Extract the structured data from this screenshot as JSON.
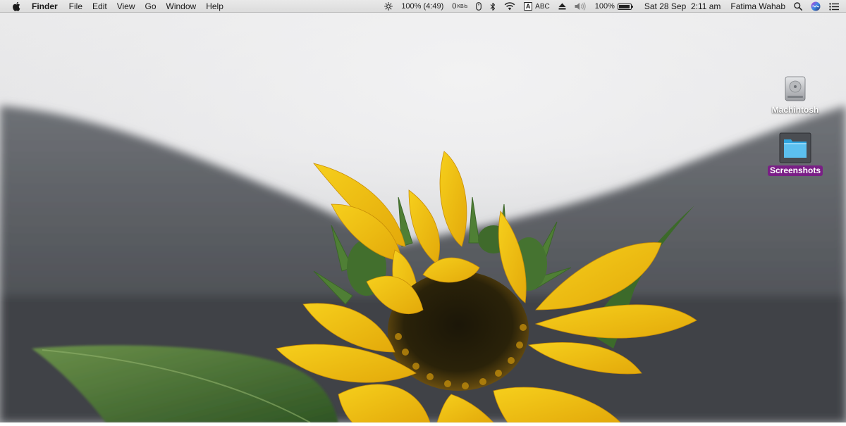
{
  "menubar": {
    "apple_icon": "apple-logo",
    "app_name": "Finder",
    "menus": [
      "File",
      "Edit",
      "View",
      "Go",
      "Window",
      "Help"
    ],
    "status": {
      "brightness_icon": "brightness-icon",
      "battery_time": "100% (4:49)",
      "network_speed_value": "0",
      "network_speed_unit_top": "KB/s",
      "mouse_icon": "mouse-icon",
      "bluetooth_icon": "bluetooth-icon",
      "wifi_icon": "wifi-icon",
      "input_source_badge": "A",
      "input_source": "ABC",
      "eject_icon": "eject-icon",
      "volume_icon": "volume-icon",
      "battery_percent": "100%",
      "battery_level": 1.0,
      "date": "Sat 28 Sep",
      "time": "2:11 am",
      "user_name": "Fatima Wahab",
      "search_icon": "spotlight-search-icon",
      "siri_icon": "siri-icon",
      "notification_icon": "notification-center-icon"
    }
  },
  "desktop": {
    "wallpaper": "sunflower-photo",
    "icons": [
      {
        "label": "Machintosh",
        "icon": "hard-drive-icon",
        "selected": false
      },
      {
        "label": "Screenshots",
        "icon": "folder-icon",
        "selected": true
      }
    ]
  },
  "colors": {
    "selection_label": "#7a1f86",
    "menubar_bg": "#e4e4e4"
  }
}
